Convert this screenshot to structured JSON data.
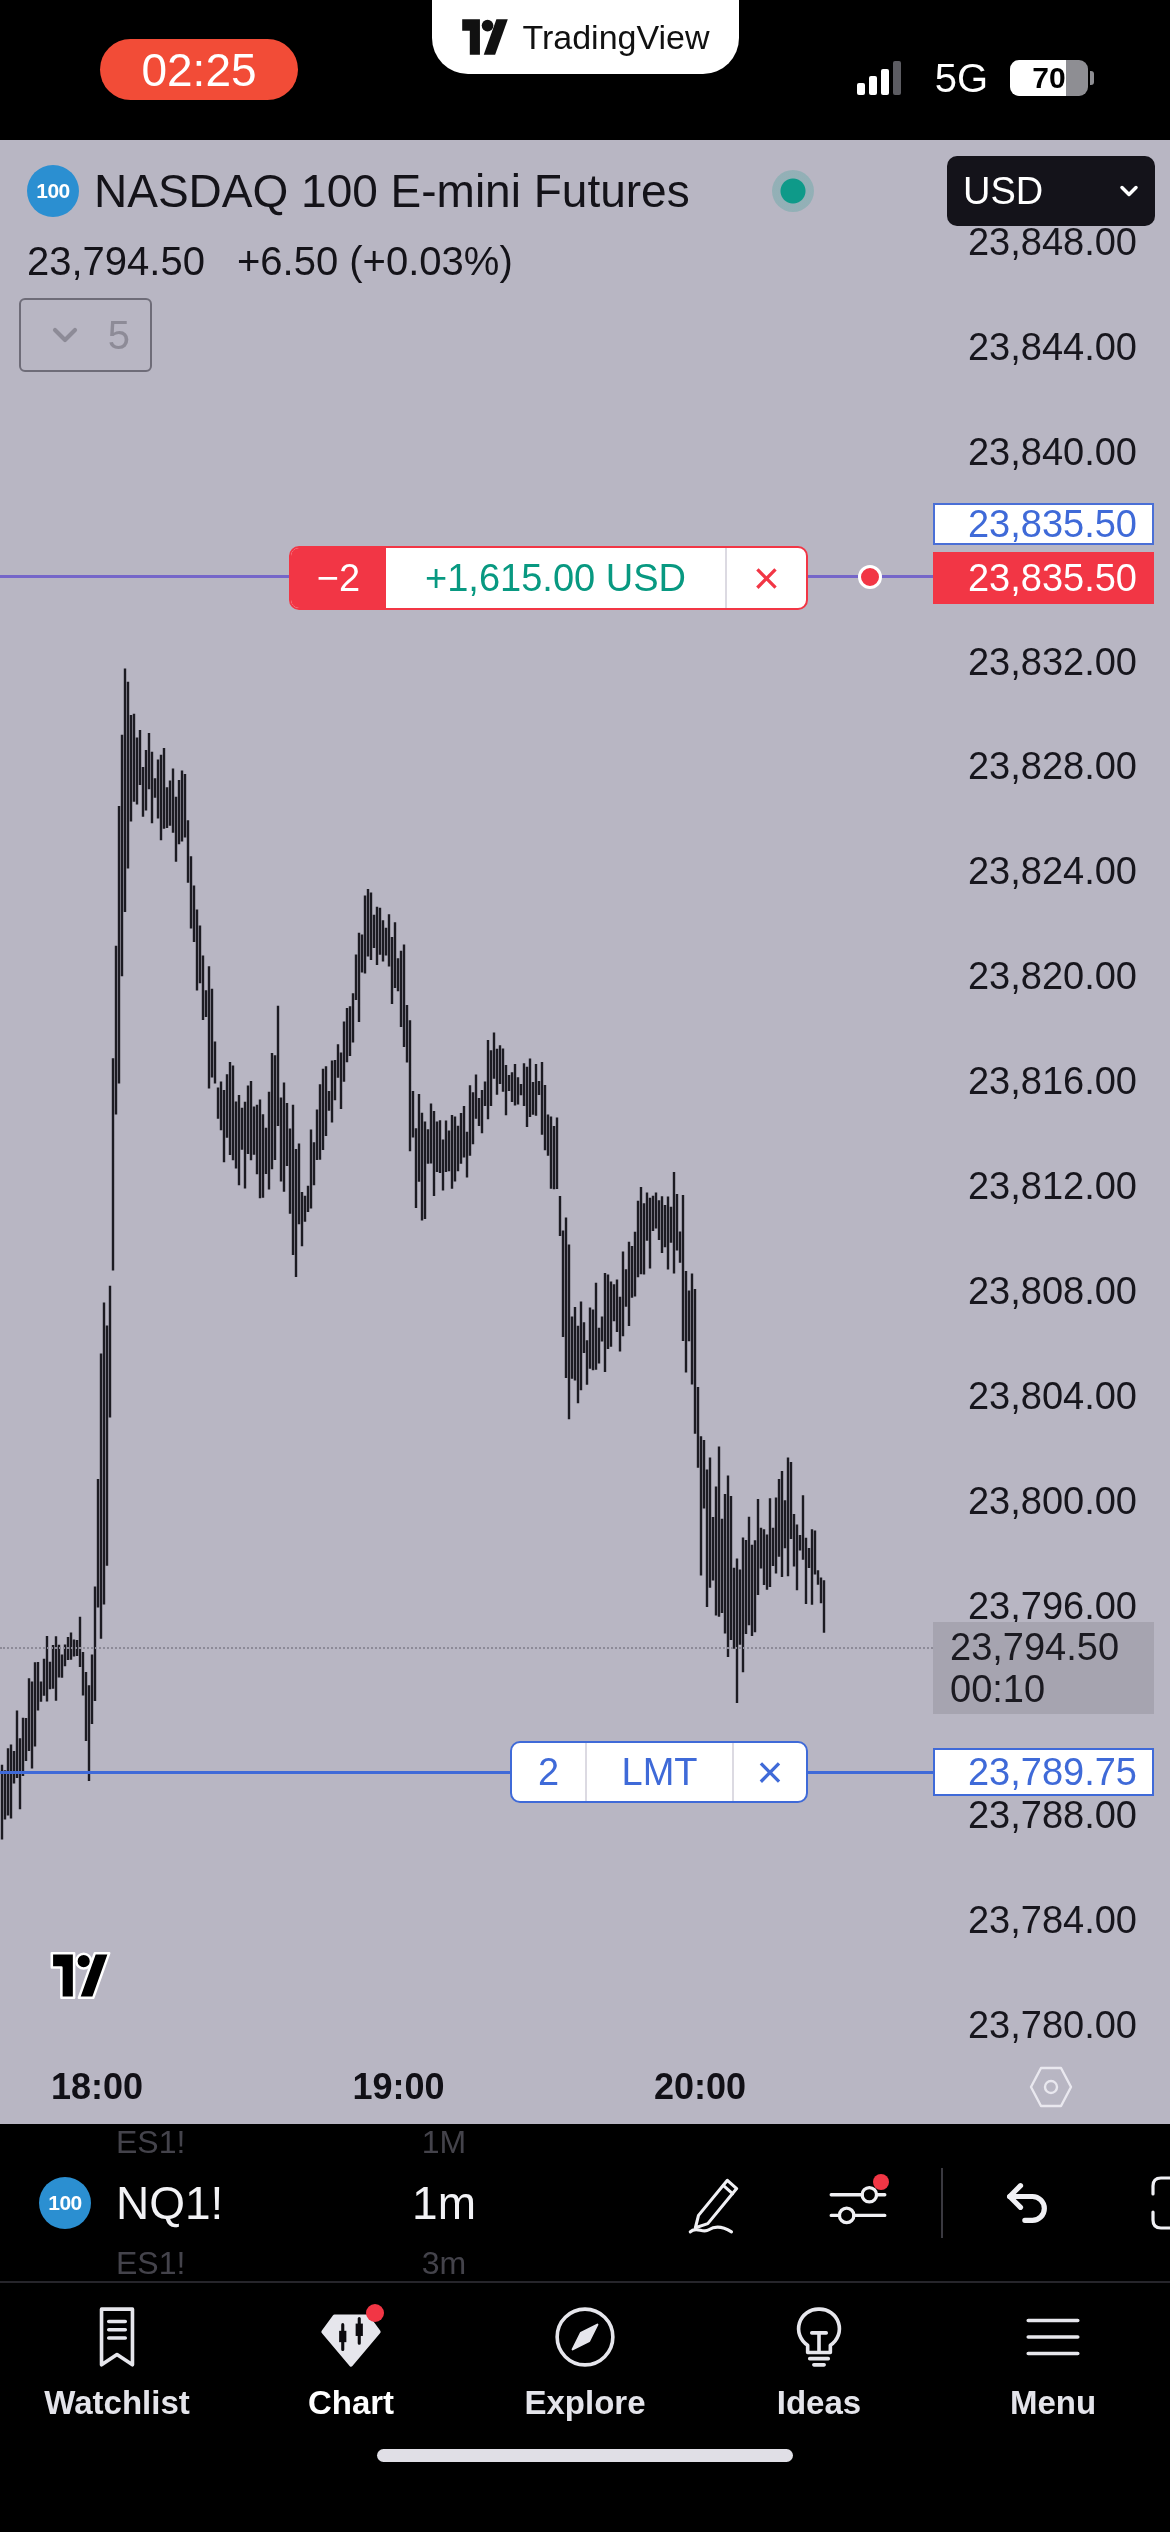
{
  "status_bar": {
    "time": "02:25",
    "island_title": "TradingView",
    "network": "5G",
    "battery": "70"
  },
  "header": {
    "symbol_badge": "100",
    "title": "NASDAQ 100 E-mini Futures",
    "market_open": true,
    "currency": "USD",
    "last_price": "23,794.50",
    "change": "+6.50 (+0.03%)",
    "collapse_count": "5"
  },
  "price_axis": {
    "upper_labels": [
      "23,848.00",
      "23,844.00",
      "23,840.00"
    ],
    "middle_labels": [
      "23,832.00",
      "23,828.00",
      "23,824.00",
      "23,820.00",
      "23,816.00",
      "23,812.00",
      "23,808.00",
      "23,804.00",
      "23,800.00",
      "23,796.00"
    ],
    "lower_labels": [
      "23,788.00",
      "23,784.00",
      "23,780.00"
    ]
  },
  "position": {
    "quantity": "−2",
    "pnl": "+1,615.00 USD",
    "close": "×",
    "outlined_tag": "23,835.50",
    "price_tag": "23,835.50"
  },
  "last_price_tag": {
    "price": "23,794.50",
    "countdown": "00:10"
  },
  "limit_order": {
    "quantity": "2",
    "type": "LMT",
    "close": "×",
    "price_tag": "23,789.75"
  },
  "time_axis": [
    "18:00",
    "19:00",
    "20:00"
  ],
  "toolbar": {
    "symbol_badge": "100",
    "symbol": "NQ1!",
    "interval": "1m",
    "picker_above": {
      "symbol": "ES1!",
      "interval": "1M"
    },
    "picker_below": {
      "symbol": "ES1!",
      "interval": "3m"
    },
    "indicators_alert": true
  },
  "tabs": [
    {
      "kind": "watchlist",
      "label": "Watchlist",
      "selected": false,
      "badge": false
    },
    {
      "kind": "chart",
      "label": "Chart",
      "selected": true,
      "badge": true
    },
    {
      "kind": "explore",
      "label": "Explore",
      "selected": false,
      "badge": false
    },
    {
      "kind": "ideas",
      "label": "Ideas",
      "selected": false,
      "badge": false
    },
    {
      "kind": "menu",
      "label": "Menu",
      "selected": false,
      "badge": false
    }
  ]
}
